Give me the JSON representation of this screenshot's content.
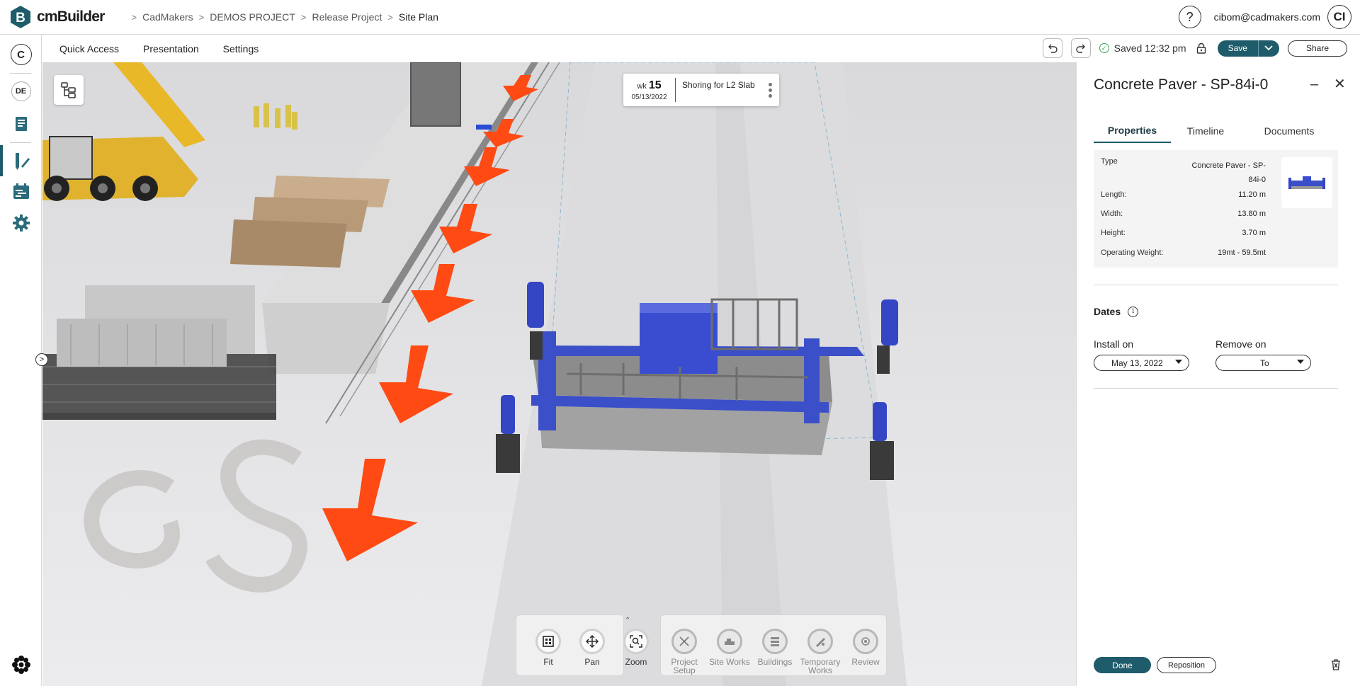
{
  "app": {
    "name": "cmBuilder",
    "brand_color": "#1f5c6b"
  },
  "breadcrumb": [
    "CadMakers",
    "DEMOS PROJECT",
    "Release Project",
    "Site Plan"
  ],
  "user": {
    "email": "cibom@cadmakers.com",
    "initials": "CI"
  },
  "left_rail": {
    "top_badge": "C",
    "project_badge": "DE",
    "icons": [
      "document-icon",
      "design-pen-icon",
      "schedule-icon",
      "settings-gear-icon"
    ],
    "bottom_icon": "apps-cluster-icon"
  },
  "menu": {
    "items": [
      "Quick Access",
      "Presentation",
      "Settings"
    ],
    "saved_status": "Saved 12:32 pm",
    "save_label": "Save",
    "share_label": "Share"
  },
  "task_card": {
    "wk_label": "wk",
    "week": "15",
    "date": "05/13/2022",
    "name": "Shoring for L2 Slab"
  },
  "nav_tools": [
    {
      "label": "Fit",
      "icon": "fit-icon"
    },
    {
      "label": "Pan",
      "icon": "pan-icon"
    },
    {
      "label": "Zoom",
      "icon": "zoom-icon"
    }
  ],
  "build_tools": [
    {
      "label": "Project\nSetup",
      "icon": "project-setup-icon"
    },
    {
      "label": "Site Works",
      "icon": "site-works-icon"
    },
    {
      "label": "Buildings",
      "icon": "buildings-icon"
    },
    {
      "label": "Temporary\nWorks",
      "icon": "temporary-works-icon"
    },
    {
      "label": "Review",
      "icon": "review-icon"
    }
  ],
  "panel": {
    "title": "Concrete Paver - SP-84i-0",
    "tabs": [
      "Properties",
      "Timeline",
      "Documents"
    ],
    "active_tab": "Properties",
    "properties": {
      "type_label": "Type",
      "type_value": "Concrete Paver - SP-84i-0",
      "length_label": "Length:",
      "length_value": "11.20 m",
      "width_label": "Width:",
      "width_value": "13.80 m",
      "height_label": "Height:",
      "height_value": "3.70 m",
      "weight_label": "Operating Weight:",
      "weight_value": "19mt - 59.5mt"
    },
    "dates": {
      "title": "Dates",
      "install_label": "Install on",
      "install_value": "May 13, 2022",
      "remove_label": "Remove on",
      "remove_value": "To"
    },
    "done_label": "Done",
    "reposition_label": "Reposition"
  }
}
